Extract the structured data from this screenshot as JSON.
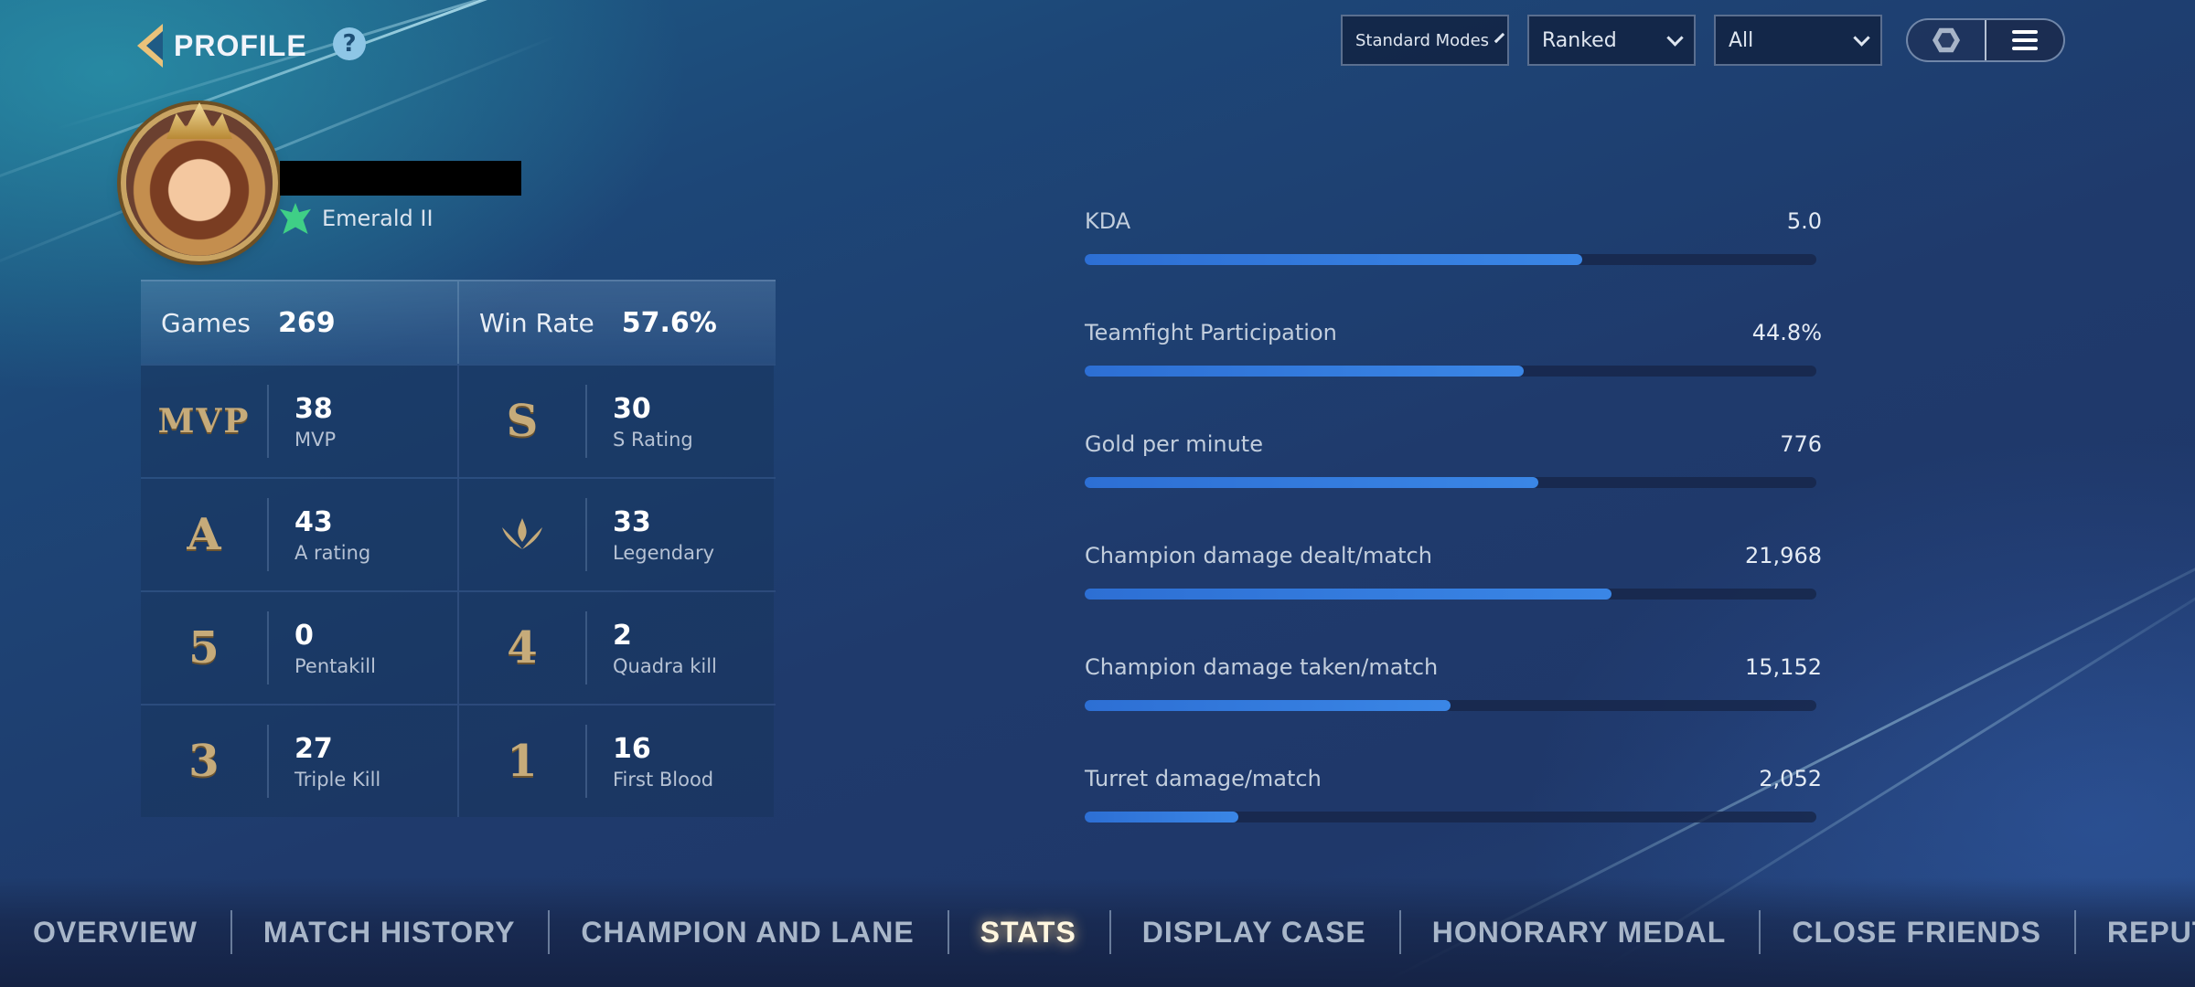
{
  "header": {
    "title": "PROFILE",
    "help": "?"
  },
  "filters": {
    "modes": "Standard Modes",
    "queue": "Ranked",
    "roles": "All"
  },
  "player": {
    "rank": "Emerald II"
  },
  "summary": {
    "games_label": "Games",
    "games_value": "269",
    "winrate_label": "Win Rate",
    "winrate_value": "57.6%"
  },
  "achievements": [
    {
      "badge": "MVP",
      "value": "38",
      "label": "MVP"
    },
    {
      "badge": "S",
      "value": "30",
      "label": "S Rating"
    },
    {
      "badge": "A",
      "value": "43",
      "label": "A rating"
    },
    {
      "badge": "legendary-icon",
      "value": "33",
      "label": "Legendary"
    },
    {
      "badge": "5",
      "value": "0",
      "label": "Pentakill"
    },
    {
      "badge": "4",
      "value": "2",
      "label": "Quadra kill"
    },
    {
      "badge": "3",
      "value": "27",
      "label": "Triple Kill"
    },
    {
      "badge": "1",
      "value": "16",
      "label": "First Blood"
    }
  ],
  "metrics": [
    {
      "label": "KDA",
      "value": "5.0",
      "fill": 0.68
    },
    {
      "label": "Teamfight Participation",
      "value": "44.8%",
      "fill": 0.6
    },
    {
      "label": "Gold per minute",
      "value": "776",
      "fill": 0.62
    },
    {
      "label": "Champion damage dealt/match",
      "value": "21,968",
      "fill": 0.72
    },
    {
      "label": "Champion damage taken/match",
      "value": "15,152",
      "fill": 0.5
    },
    {
      "label": "Turret damage/match",
      "value": "2,052",
      "fill": 0.21
    }
  ],
  "tabs": [
    {
      "label": "OVERVIEW"
    },
    {
      "label": "MATCH HISTORY"
    },
    {
      "label": "CHAMPION AND LANE"
    },
    {
      "label": "STATS",
      "active": true
    },
    {
      "label": "DISPLAY CASE"
    },
    {
      "label": "HONORARY MEDAL"
    },
    {
      "label": "CLOSE FRIENDS"
    },
    {
      "label": "REPUTATION"
    }
  ],
  "colors": {
    "accent_gold": "#e9c27a",
    "bar_fill": "#2d6fd4",
    "rank_green": "#3fcf86"
  }
}
